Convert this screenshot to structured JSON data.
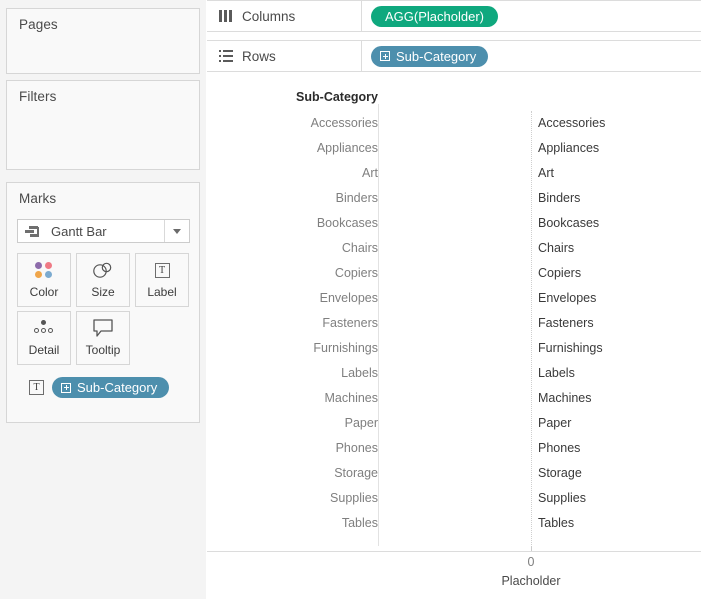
{
  "sidebar": {
    "cards": [
      {
        "title": "Pages"
      },
      {
        "title": "Filters"
      },
      {
        "title": "Marks"
      }
    ],
    "marks": {
      "title": "Marks",
      "mark_type": "Gantt Bar",
      "mark_type_icon": "gantt-bar-icon",
      "dropdown_icon": "chevron-down-icon",
      "buttons": [
        {
          "label": "Color",
          "icon": "color-dots-icon"
        },
        {
          "label": "Size",
          "icon": "size-circles-icon"
        },
        {
          "label": "Label",
          "icon": "text-label-icon"
        },
        {
          "label": "Detail",
          "icon": "detail-dots-icon"
        },
        {
          "label": "Tooltip",
          "icon": "tooltip-bubble-icon"
        }
      ],
      "pill": {
        "label": "Sub-Category",
        "role_icon": "text-label-icon",
        "hierarchy_icon": "expand-plus-icon",
        "color": "#4d8fad"
      }
    }
  },
  "shelves": {
    "columns": {
      "label": "Columns",
      "icon": "columns-icon",
      "pill": {
        "label": "AGG(Placholder)",
        "color": "#0fa87e",
        "hierarchy_icon": null
      }
    },
    "rows": {
      "label": "Rows",
      "icon": "rows-icon",
      "pill": {
        "label": "Sub-Category",
        "color": "#4d8fad",
        "hierarchy_icon": "expand-plus-icon"
      }
    }
  },
  "viz": {
    "row_field_header": "Sub-Category",
    "axis_title": "Placholder",
    "axis_tick_label": "0",
    "rows": [
      "Accessories",
      "Appliances",
      "Art",
      "Binders",
      "Bookcases",
      "Chairs",
      "Copiers",
      "Envelopes",
      "Fasteners",
      "Furnishings",
      "Labels",
      "Machines",
      "Paper",
      "Phones",
      "Storage",
      "Supplies",
      "Tables"
    ]
  },
  "chart_data": {
    "type": "bar",
    "title": "",
    "subtitle": "",
    "xlabel": "Placholder",
    "ylabel": "Sub-Category",
    "categories": [
      "Accessories",
      "Appliances",
      "Art",
      "Binders",
      "Bookcases",
      "Chairs",
      "Copiers",
      "Envelopes",
      "Fasteners",
      "Furnishings",
      "Labels",
      "Machines",
      "Paper",
      "Phones",
      "Storage",
      "Supplies",
      "Tables"
    ],
    "values": [
      0,
      0,
      0,
      0,
      0,
      0,
      0,
      0,
      0,
      0,
      0,
      0,
      0,
      0,
      0,
      0,
      0
    ],
    "data_labels": [
      "Accessories",
      "Appliances",
      "Art",
      "Binders",
      "Bookcases",
      "Chairs",
      "Copiers",
      "Envelopes",
      "Fasteners",
      "Furnishings",
      "Labels",
      "Machines",
      "Paper",
      "Phones",
      "Storage",
      "Supplies",
      "Tables"
    ],
    "xticks": [
      "0"
    ],
    "xlim": [
      0,
      0
    ],
    "grid": true,
    "legend": "none",
    "mark_type": "Gantt Bar",
    "note": "Gantt bars have zero width at x=0; only mark text labels are rendered."
  }
}
